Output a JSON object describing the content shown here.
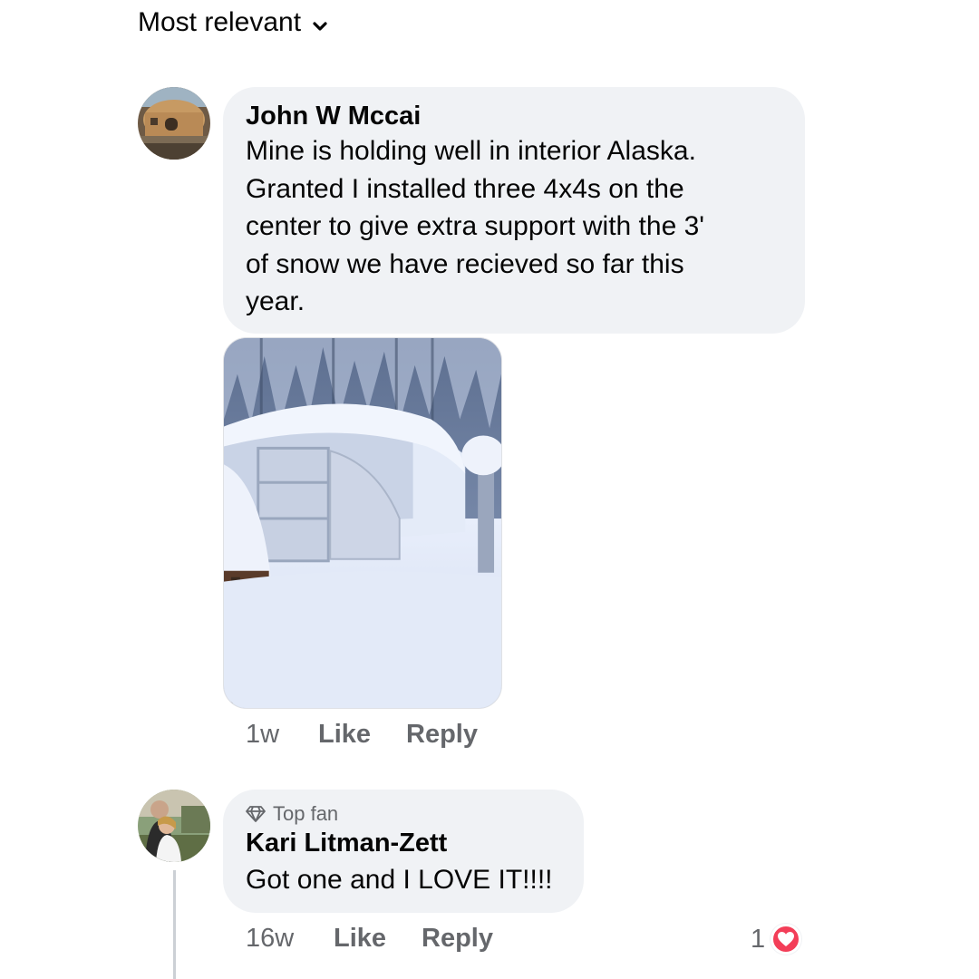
{
  "sort": {
    "label": "Most relevant",
    "icon": "chevron-down-icon"
  },
  "comments": [
    {
      "author": "John W Mccai",
      "text_lines": [
        "Mine is holding well in interior Alaska.",
        "Granted I installed three 4x4s on the",
        "center to give extra support with the 3'",
        "of snow we have recieved so far this",
        "year."
      ],
      "time": "1w",
      "like_label": "Like",
      "reply_label": "Reply"
    },
    {
      "badge": "Top fan",
      "badge_icon": "diamond-icon",
      "author": "Kari Litman-Zett",
      "text": "Got one and I LOVE IT!!!!",
      "time": "16w",
      "like_label": "Like",
      "reply_label": "Reply",
      "reaction_count": "1",
      "reaction_icon": "heart-icon"
    }
  ],
  "colors": {
    "bubble": "#f0f2f5",
    "meta_text": "#65676b",
    "heart": "#f33e58"
  }
}
